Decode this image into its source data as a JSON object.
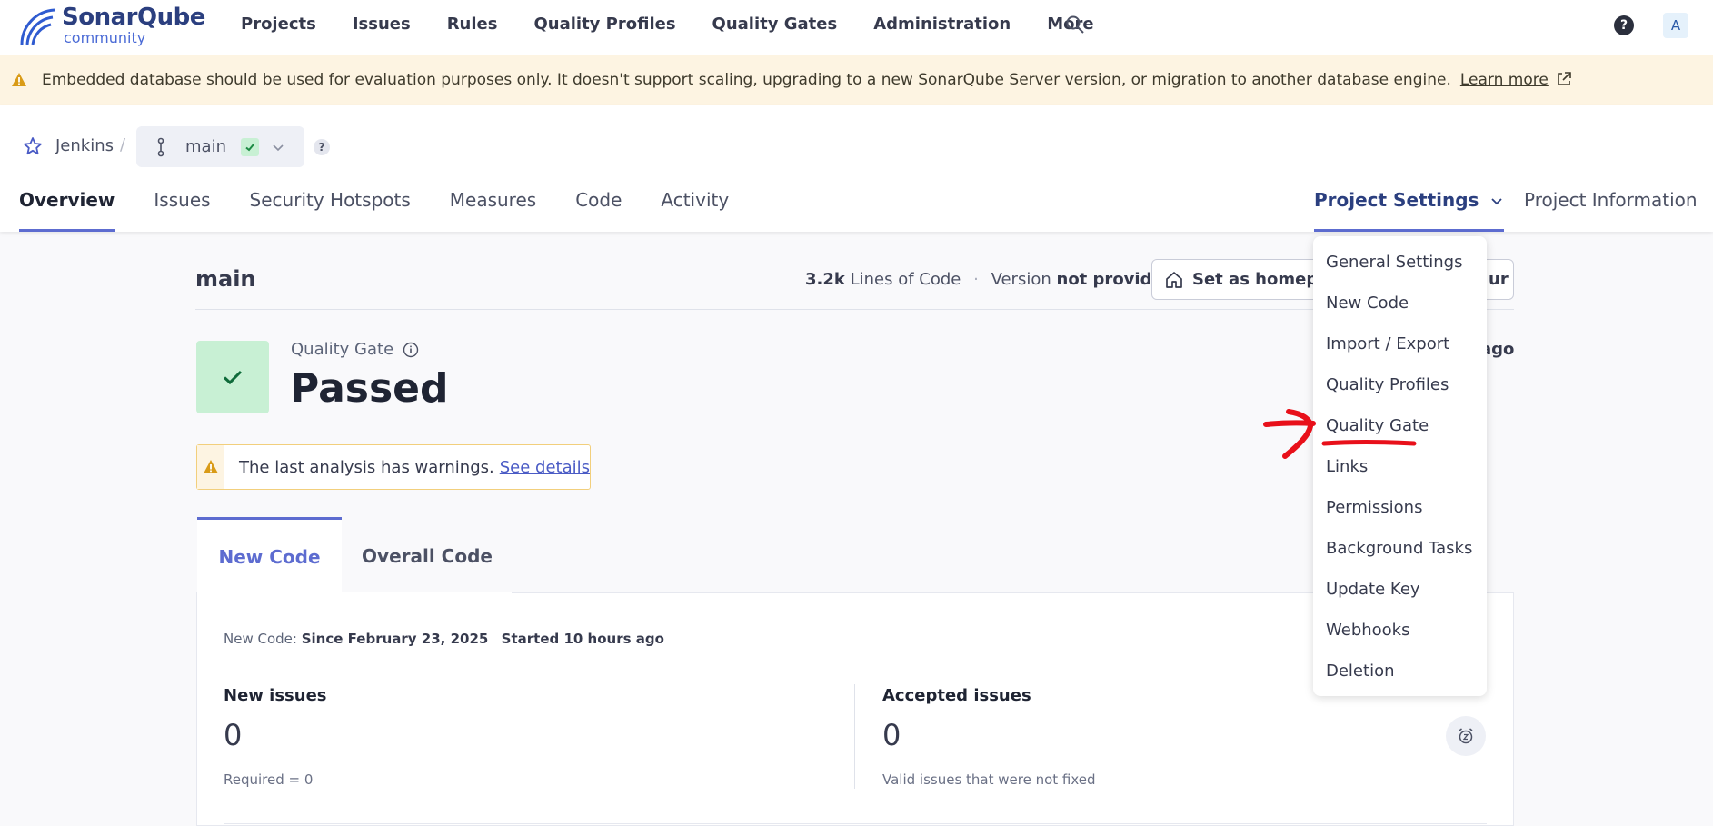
{
  "app": {
    "brand": "SonarQube",
    "edition": "community"
  },
  "nav": {
    "items": [
      "Projects",
      "Issues",
      "Rules",
      "Quality Profiles",
      "Quality Gates",
      "Administration",
      "More"
    ],
    "avatar_initial": "A",
    "help_glyph": "?"
  },
  "banner": {
    "text": "Embedded database should be used for evaluation purposes only. It doesn't support scaling, upgrading to a new SonarQube Server version, or migration to another database engine.",
    "link": "Learn more"
  },
  "breadcrumb": {
    "project": "Jenkins",
    "separator": "/",
    "branch": "main",
    "help_glyph": "?"
  },
  "project_tabs": {
    "items": [
      "Overview",
      "Issues",
      "Security Hotspots",
      "Measures",
      "Code",
      "Activity"
    ],
    "settings": "Project Settings",
    "information": "Project Information"
  },
  "header": {
    "title": "main",
    "loc_value": "3.2k",
    "loc_label": "Lines of Code",
    "version_label": "Version",
    "version_value": "not provided",
    "dot": "·",
    "homepage_button": "Set as homepage",
    "hidden_tail": "ur",
    "analysis_ago": "ago"
  },
  "quality_gate": {
    "label": "Quality Gate",
    "status": "Passed",
    "status_color": "#c8f0d4"
  },
  "warning": {
    "text": "The last analysis has warnings.",
    "link": "See details"
  },
  "code_tabs": {
    "new_code": "New Code",
    "overall_code": "Overall Code"
  },
  "new_code_period": {
    "label": "New Code:",
    "since": "Since February 23, 2025",
    "started": "Started 10 hours ago"
  },
  "metrics": {
    "new_issues_label": "New issues",
    "new_issues_value": "0",
    "new_issues_sub": "Required = 0",
    "accepted_issues_label": "Accepted issues",
    "accepted_issues_value": "0",
    "accepted_issues_sub": "Valid issues that were not fixed"
  },
  "settings_menu": {
    "items": [
      "General Settings",
      "New Code",
      "Import / Export",
      "Quality Profiles",
      "Quality Gate",
      "Links",
      "Permissions",
      "Background Tasks",
      "Update Key",
      "Webhooks",
      "Deletion"
    ]
  },
  "colors": {
    "accent": "#5d6cd0",
    "annotation": "#e8101a",
    "banner_bg": "#fdf4e2"
  }
}
